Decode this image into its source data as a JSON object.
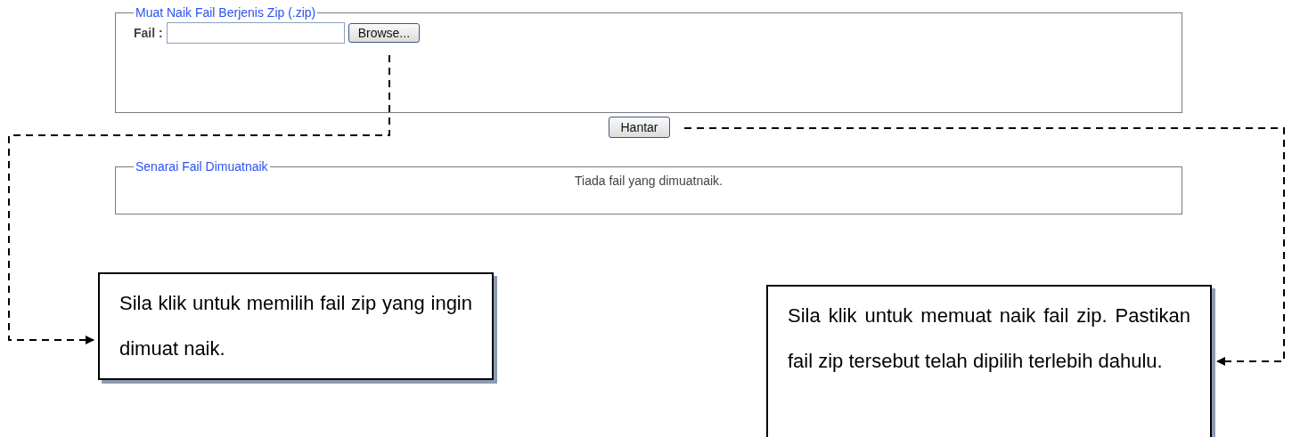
{
  "upload_panel": {
    "legend": "Muat Naik Fail Berjenis Zip (.zip)",
    "file_label": "Fail :",
    "browse_button": "Browse..."
  },
  "submit_button": "Hantar",
  "uploaded_panel": {
    "legend": "Senarai Fail Dimuatnaik",
    "message": "Tiada fail yang dimuatnaik."
  },
  "callouts": [
    {
      "text": "Sila klik untuk memilih fail zip yang ingin dimuat naik."
    },
    {
      "text": "Sila klik untuk memuat naik fail zip. Pastikan fail zip tersebut telah dipilih terlebih dahulu."
    }
  ]
}
